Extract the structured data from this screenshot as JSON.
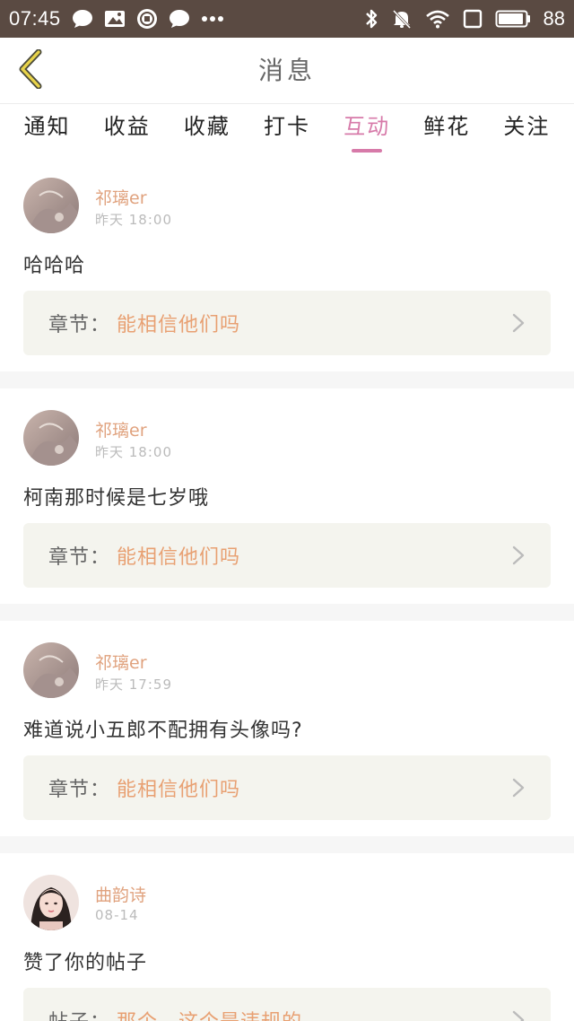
{
  "status_bar": {
    "time": "07:45",
    "battery": "88",
    "left_icons": [
      "chat-bubble-icon",
      "image-icon",
      "xiu-app-icon",
      "chat-bubble-icon",
      "more-dots-icon"
    ],
    "right_icons": [
      "bluetooth-icon",
      "muted-bell-icon",
      "wifi-icon",
      "square-icon",
      "battery-icon"
    ]
  },
  "header": {
    "title": "消息"
  },
  "tabs": [
    {
      "label": "通知",
      "active": false
    },
    {
      "label": "收益",
      "active": false
    },
    {
      "label": "收藏",
      "active": false
    },
    {
      "label": "打卡",
      "active": false
    },
    {
      "label": "互动",
      "active": true
    },
    {
      "label": "鲜花",
      "active": false
    },
    {
      "label": "关注",
      "active": false
    }
  ],
  "messages": [
    {
      "username": "祁璃er",
      "time": "昨天  18:00",
      "content": "哈哈哈",
      "ref_label": "章节",
      "ref_colon": "：",
      "ref_title": "能相信他们吗"
    },
    {
      "username": "祁璃er",
      "time": "昨天  18:00",
      "content": "柯南那时候是七岁哦",
      "ref_label": "章节",
      "ref_colon": "：",
      "ref_title": "能相信他们吗"
    },
    {
      "username": "祁璃er",
      "time": "昨天  17:59",
      "content": "难道说小五郎不配拥有头像吗?",
      "ref_label": "章节",
      "ref_colon": "：",
      "ref_title": "能相信他们吗"
    },
    {
      "username": "曲韵诗",
      "time": "08-14",
      "content": "赞了你的帖子",
      "ref_label": "帖子",
      "ref_colon": "：",
      "ref_title": "那个，这个是违规的"
    }
  ],
  "colors": {
    "status_bar_bg": "#5a4a42",
    "accent_pink": "#d77aa9",
    "username": "#e0a27e",
    "ref_title": "#e8a072",
    "ref_box_bg": "#f4f4ee",
    "back_arrow": "#e8d34a"
  }
}
